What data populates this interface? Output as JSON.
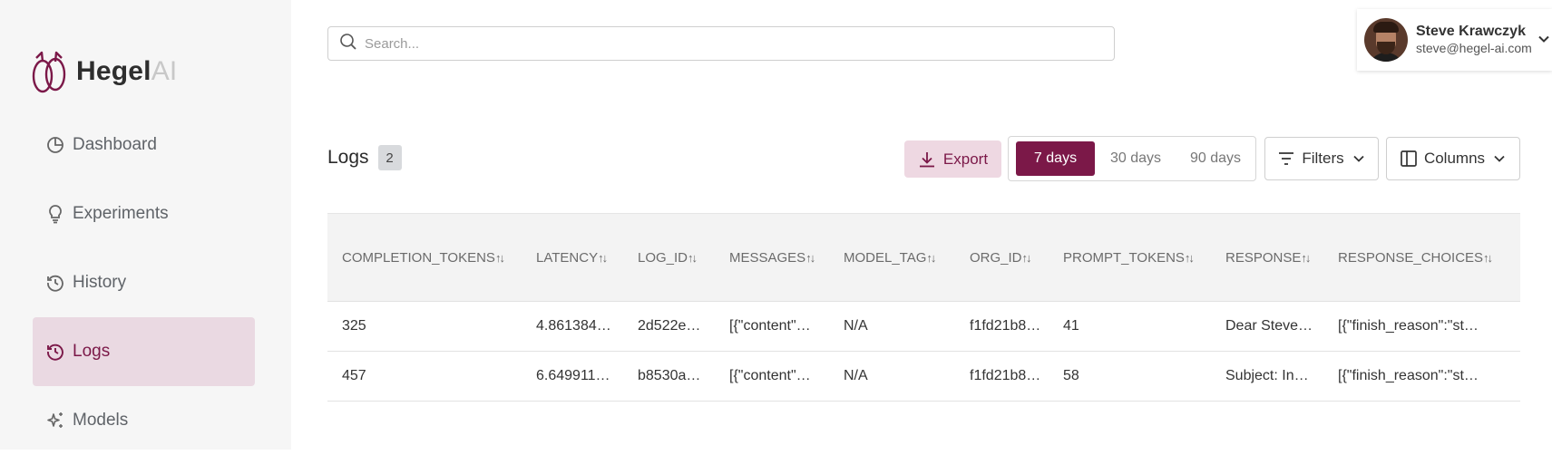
{
  "brand": {
    "name_bold": "Hegel",
    "name_light": "AI"
  },
  "sidebar": {
    "items": [
      {
        "label": "Dashboard",
        "icon": "pie-chart-icon"
      },
      {
        "label": "Experiments",
        "icon": "lightbulb-icon"
      },
      {
        "label": "History",
        "icon": "history-icon"
      },
      {
        "label": "Logs",
        "icon": "history-icon"
      },
      {
        "label": "Models",
        "icon": "sparkles-icon"
      }
    ],
    "active": "Logs"
  },
  "search": {
    "placeholder": "Search...",
    "value": ""
  },
  "user": {
    "name": "Steve Krawczyk",
    "email": "steve@hegel-ai.com"
  },
  "logs": {
    "title": "Logs",
    "count": "2",
    "export_label": "Export",
    "ranges": [
      "7 days",
      "30 days",
      "90 days"
    ],
    "selected_range": "7 days",
    "filters_label": "Filters",
    "columns_label": "Columns"
  },
  "table": {
    "sort_icon": "↑↓",
    "headers": [
      "COMPLETION_TOKENS",
      "LATENCY",
      "LOG_ID",
      "MESSAGES",
      "MODEL_TAG",
      "ORG_ID",
      "PROMPT_TOKENS",
      "RESPONSE",
      "RESPONSE_CHOICES"
    ],
    "rows": [
      [
        "325",
        "4.861384…",
        "2d522e…",
        "[{\"content\"…",
        "N/A",
        "f1fd21b8…",
        "41",
        "Dear Steve…",
        "[{\"finish_reason\":\"st…"
      ],
      [
        "457",
        "6.649911…",
        "b8530a…",
        "[{\"content\"…",
        "N/A",
        "f1fd21b8…",
        "58",
        "Subject: In…",
        "[{\"finish_reason\":\"st…"
      ]
    ]
  },
  "colors": {
    "accent": "#7b1848",
    "accent_light": "#ead9e2",
    "sidebar_bg": "#f6f6f6"
  }
}
